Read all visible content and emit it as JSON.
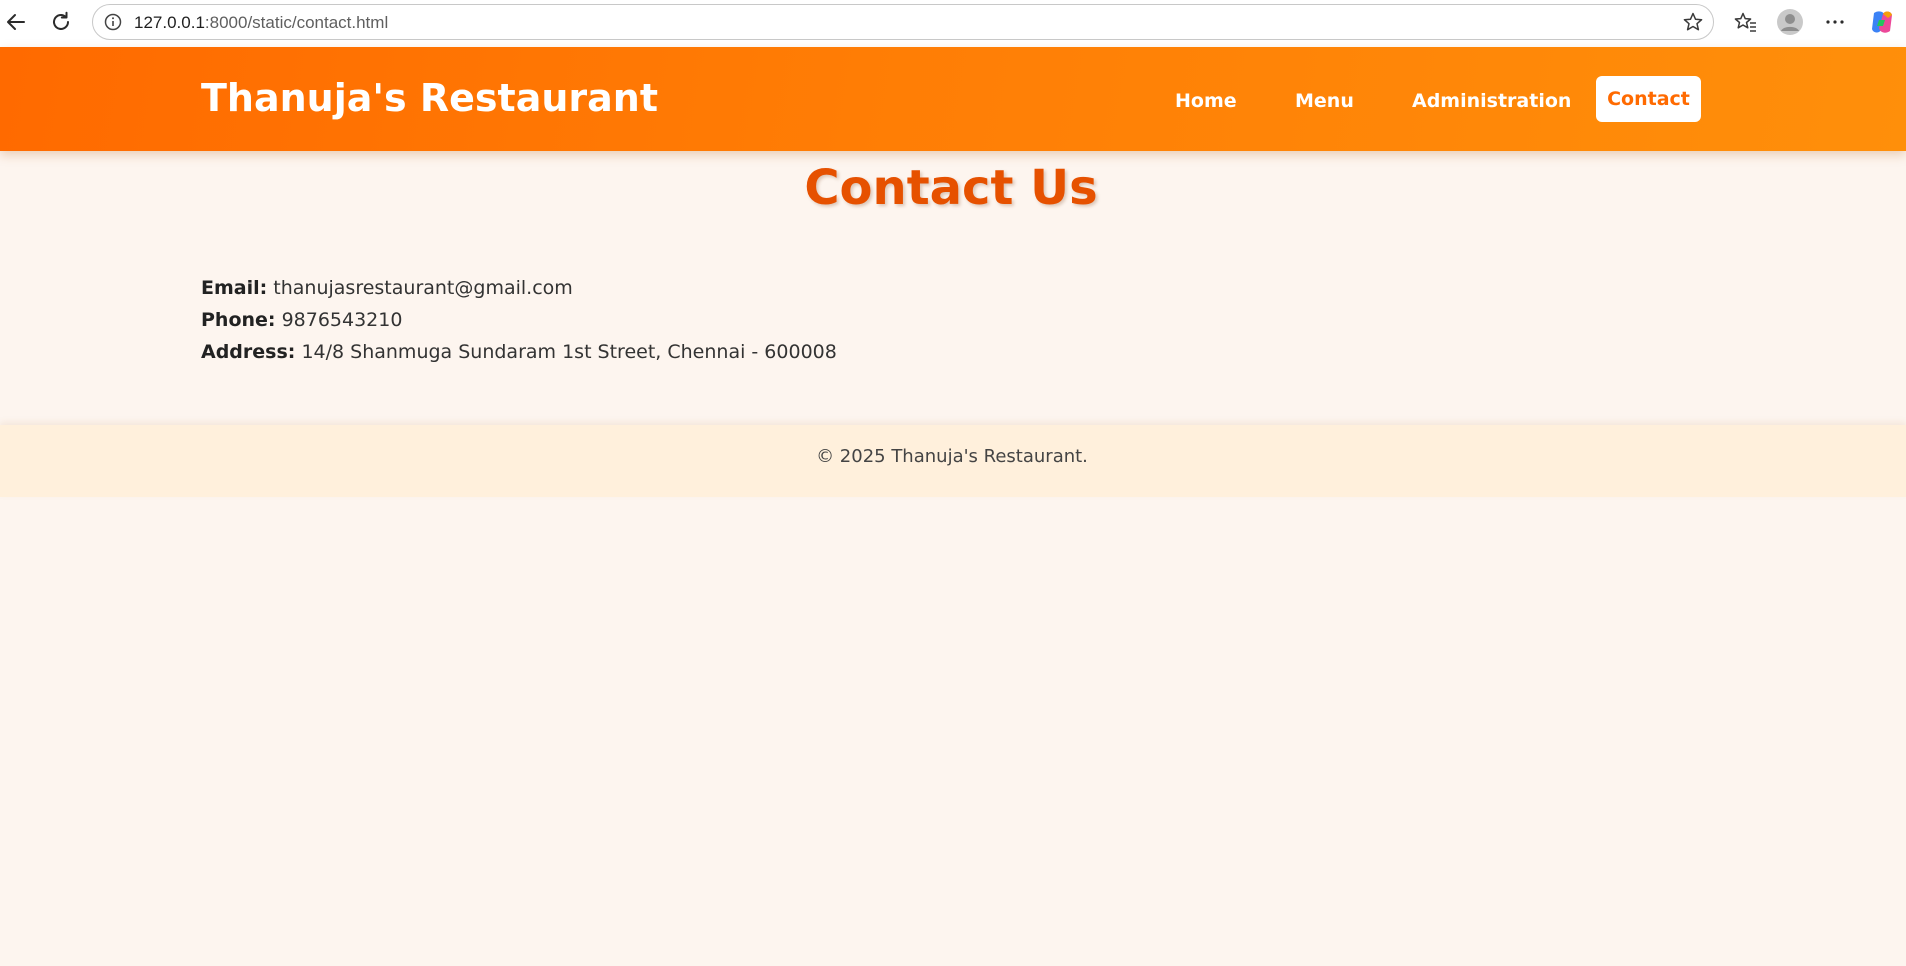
{
  "browser": {
    "url_host": "127.0.0.1",
    "url_rest": ":8000/static/contact.html",
    "icons": [
      "back-arrow-icon",
      "reload-icon",
      "site-info-icon",
      "favorite-star-icon",
      "favorites-list-icon",
      "profile-avatar-icon",
      "more-menu-icon",
      "copilot-icon"
    ]
  },
  "header": {
    "brand": "Thanuja's Restaurant",
    "nav": {
      "home": "Home",
      "menu": "Menu",
      "administration": "Administration",
      "contact": "Contact"
    }
  },
  "main": {
    "title": "Contact Us",
    "contact": {
      "email_label": "Email:",
      "email_value": "thanujasrestaurant@gmail.com",
      "phone_label": "Phone:",
      "phone_value": "9876543210",
      "address_label": "Address:",
      "address_value": "14/8 Shanmuga Sundaram 1st Street, Chennai - 600008"
    }
  },
  "footer": {
    "text": "© 2025 Thanuja's Restaurant."
  },
  "colors": {
    "header_gradient_start": "#ff6a00",
    "header_gradient_end": "#ff8f0a",
    "title": "#e65100",
    "page_background": "#fdf5ef",
    "footer_background": "#fff0dc"
  }
}
